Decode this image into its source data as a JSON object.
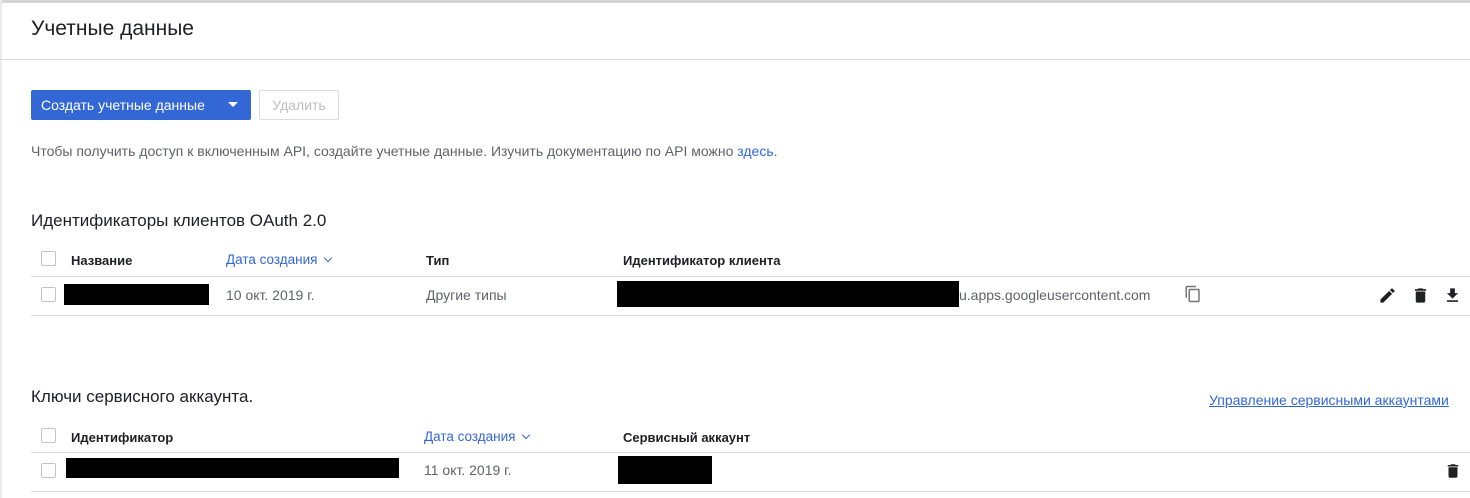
{
  "page": {
    "title": "Учетные данные"
  },
  "toolbar": {
    "create_label": "Создать учетные данные",
    "delete_label": "Удалить"
  },
  "intro": {
    "text": "Чтобы получить доступ к включенным API, создайте учетные данные. Изучить документацию по API можно ",
    "link": "здесь",
    "suffix": "."
  },
  "oauth": {
    "title": "Идентификаторы клиентов OAuth 2.0",
    "columns": {
      "name": "Название",
      "created": "Дата создания",
      "type": "Тип",
      "client_id": "Идентификатор клиента"
    },
    "rows": [
      {
        "created": "10 окт. 2019 г.",
        "type": "Другие типы",
        "client_id_suffix": "u.apps.googleusercontent.com"
      }
    ]
  },
  "service_keys": {
    "title": "Ключи сервисного аккаунта.",
    "manage_link": "Управление сервисными аккаунтами",
    "columns": {
      "id": "Идентификатор",
      "created": "Дата создания",
      "account": "Сервисный аккаунт"
    },
    "rows": [
      {
        "created": "11 окт. 2019 г."
      }
    ]
  },
  "icons": [
    "copy-icon",
    "edit-icon",
    "delete-icon",
    "download-icon",
    "dropdown-caret-icon",
    "sort-chevron-icon"
  ],
  "colors": {
    "accent": "#3367d6",
    "text": "#202124",
    "muted": "#5f6368",
    "divider": "#dadce0"
  }
}
